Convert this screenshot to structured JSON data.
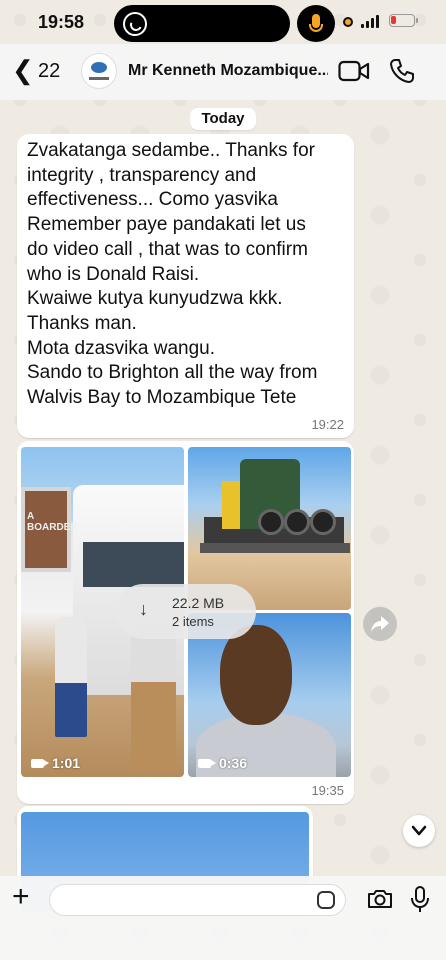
{
  "status_bar": {
    "time": "19:58"
  },
  "header": {
    "back_count": "22",
    "contact_name": "Mr Kenneth Mozambique...",
    "icons": [
      "chevron-left-icon",
      "video-call-icon",
      "phone-icon"
    ]
  },
  "date_label": "Today",
  "message": {
    "lines": [
      "Zvakatanga sedambe.. Thanks for",
      "integrity , transparency and",
      "effectiveness... Como yasvika",
      "Remember paye pandakati let us",
      "do video call , that was to confirm",
      "who is Donald Raisi.",
      "Kwaiwe kutya kunyudzwa kkk.",
      "Thanks man.",
      "Mota dzasvika wangu.",
      "Sando to Brighton all the way from",
      "Walvis Bay to Mozambique Tete"
    ],
    "time": "19:22"
  },
  "media_message": {
    "sign_text": "A BOARDER",
    "download_size": "22.2 MB",
    "download_items": "2 items",
    "video1_duration": "1:01",
    "video2_duration": "0:36",
    "time": "19:35"
  },
  "colors": {
    "chat_bg": "#efeae2",
    "bubble": "#ffffff",
    "accent_orange": "#f5a623",
    "battery_low": "#e53935"
  }
}
